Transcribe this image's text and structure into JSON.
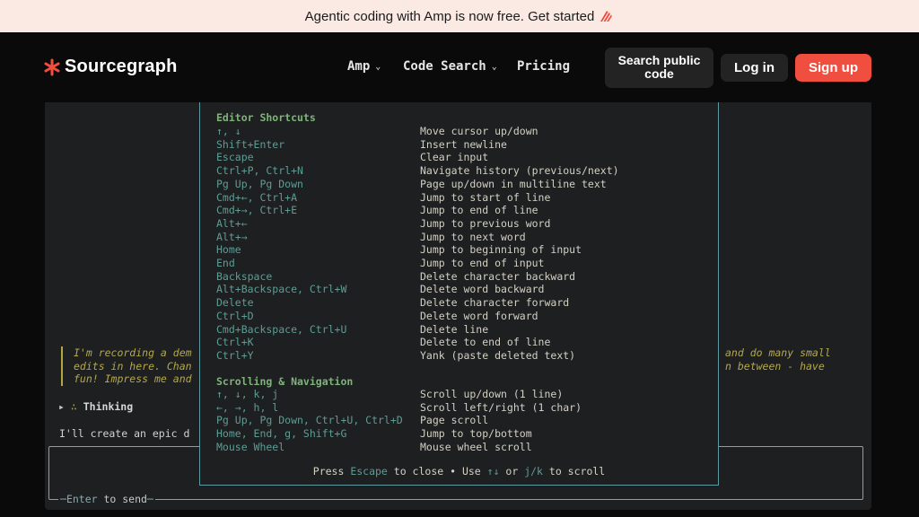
{
  "banner": {
    "text": "Agentic coding with Amp is now free. Get started",
    "icon": "amp-icon"
  },
  "nav": {
    "logo": "Sourcegraph",
    "items": [
      {
        "label": "Amp",
        "has_menu": true
      },
      {
        "label": "Code Search",
        "has_menu": true
      },
      {
        "label": "Pricing",
        "has_menu": false
      }
    ],
    "search_button": [
      "Search public",
      "code"
    ],
    "login": "Log in",
    "signup": "Sign up",
    "colors": {
      "accent": "#f04e3e"
    }
  },
  "modal": {
    "editor_title": "Editor Shortcuts",
    "editor": [
      {
        "key": "↑, ↓",
        "desc": "Move cursor up/down"
      },
      {
        "key": "Shift+Enter",
        "desc": "Insert newline"
      },
      {
        "key": "Escape",
        "desc": "Clear input"
      },
      {
        "key": "Ctrl+P, Ctrl+N",
        "desc": "Navigate history (previous/next)"
      },
      {
        "key": "Pg Up, Pg Down",
        "desc": "Page up/down in multiline text"
      },
      {
        "key": "Cmd+←, Ctrl+A",
        "desc": "Jump to start of line"
      },
      {
        "key": "Cmd+→, Ctrl+E",
        "desc": "Jump to end of line"
      },
      {
        "key": "Alt+←",
        "desc": "Jump to previous word"
      },
      {
        "key": "Alt+→",
        "desc": "Jump to next word"
      },
      {
        "key": "Home",
        "desc": "Jump to beginning of input"
      },
      {
        "key": "End",
        "desc": "Jump to end of input"
      },
      {
        "key": "Backspace",
        "desc": "Delete character backward"
      },
      {
        "key": "Alt+Backspace, Ctrl+W",
        "desc": "Delete word backward"
      },
      {
        "key": "Delete",
        "desc": "Delete character forward"
      },
      {
        "key": "Ctrl+D",
        "desc": "Delete word forward"
      },
      {
        "key": "Cmd+Backspace, Ctrl+U",
        "desc": "Delete line"
      },
      {
        "key": "Ctrl+K",
        "desc": "Delete to end of line"
      },
      {
        "key": "Ctrl+Y",
        "desc": "Yank (paste deleted text)"
      }
    ],
    "nav_title": "Scrolling & Navigation",
    "navigation": [
      {
        "key": "↑, ↓, k, j",
        "desc": "Scroll up/down (1 line)"
      },
      {
        "key": "←, →, h, l",
        "desc": "Scroll left/right (1 char)"
      },
      {
        "key": "Pg Up, Pg Down, Ctrl+U, Ctrl+D",
        "desc": "Page scroll"
      },
      {
        "key": "Home, End, g, Shift+G",
        "desc": "Jump to top/bottom"
      },
      {
        "key": "Mouse Wheel",
        "desc": "Mouse wheel scroll"
      }
    ],
    "footer": {
      "press": "Press ",
      "escape": "Escape",
      "to_close": " to close • Use ",
      "arrows": "↑↓",
      "or": " or ",
      "jk": "j/k",
      "to_scroll": " to scroll"
    }
  },
  "terminal": {
    "quote_lines": [
      "I'm recording a dem",
      "edits in here. Chan",
      "fun! Impress me and"
    ],
    "quote_right": [
      "and do many small",
      "n between - have"
    ],
    "thinking": "Thinking",
    "reply": "I'll create an epic d",
    "input_hint_key": "Enter",
    "input_hint_text": " to send"
  }
}
